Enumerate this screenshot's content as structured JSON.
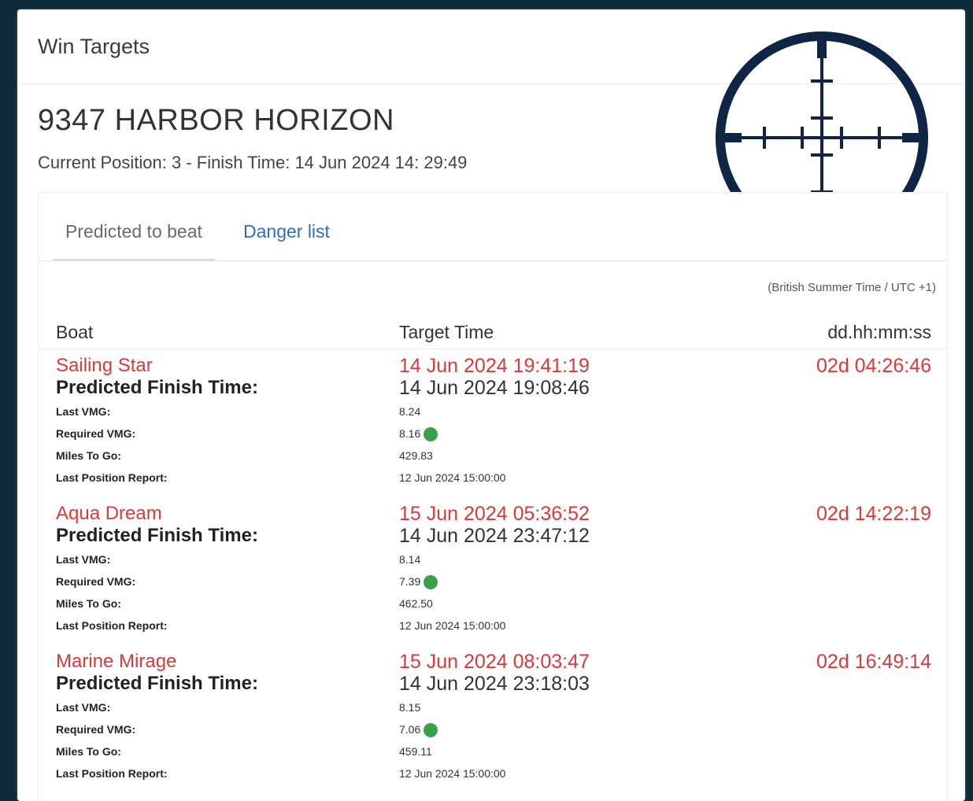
{
  "panel_title": "Win Targets",
  "boat_title": "9347 HARBOR HORIZON",
  "status_line": "Current Position: 3 - Finish Time: 14 Jun 2024 14: 29:49",
  "tabs": [
    {
      "label": "Predicted to beat",
      "active": false
    },
    {
      "label": "Danger list",
      "active": true
    }
  ],
  "timezone_note": "(British Summer Time / UTC +1)",
  "table": {
    "headers": {
      "boat": "Boat",
      "target_time": "Target Time",
      "duration": "dd.hh:mm:ss"
    },
    "detail_labels": {
      "predicted_finish": "Predicted Finish Time:",
      "last_vmg": "Last VMG:",
      "required_vmg": "Required VMG:",
      "miles_to_go": "Miles To Go:",
      "last_position_report": "Last Position Report:"
    },
    "rows": [
      {
        "boat": "Sailing Star",
        "target_time": "14 Jun 2024 19:41:19",
        "predicted_finish": "14 Jun 2024 19:08:46",
        "duration": "02d 04:26:46",
        "last_vmg": "8.24",
        "required_vmg": "8.16",
        "miles_to_go": "429.83",
        "last_position_report": "12 Jun 2024 15:00:00",
        "status_color": "#3aa04a"
      },
      {
        "boat": "Aqua Dream",
        "target_time": "15 Jun 2024 05:36:52",
        "predicted_finish": "14 Jun 2024 23:47:12",
        "duration": "02d 14:22:19",
        "last_vmg": "8.14",
        "required_vmg": "7.39",
        "miles_to_go": "462.50",
        "last_position_report": "12 Jun 2024 15:00:00",
        "status_color": "#3aa04a"
      },
      {
        "boat": "Marine Mirage",
        "target_time": "15 Jun 2024 08:03:47",
        "predicted_finish": "14 Jun 2024 23:18:03",
        "duration": "02d 16:49:14",
        "last_vmg": "8.15",
        "required_vmg": "7.06",
        "miles_to_go": "459.11",
        "last_position_report": "12 Jun 2024 15:00:00",
        "status_color": "#3aa04a"
      }
    ]
  },
  "colors": {
    "accent_red": "#d73b3b",
    "link_blue": "#2f6fb5",
    "crosshair": "#0f2546",
    "status_green": "#3aa04a"
  },
  "icons": {
    "crosshair": "crosshair-icon",
    "status_dot": "status-dot-icon"
  }
}
